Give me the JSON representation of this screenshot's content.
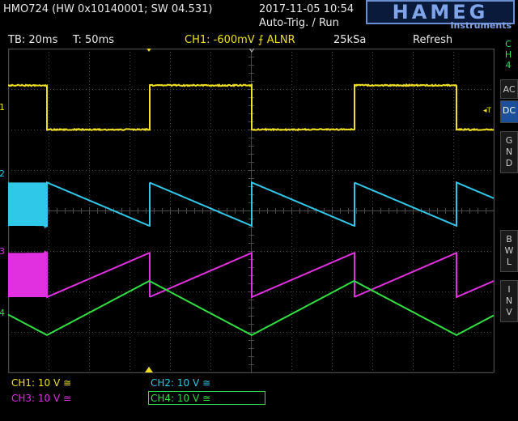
{
  "header": {
    "device_info": "HMO724 (HW 0x10140001; SW 04.531)",
    "datetime": "2017-11-05 10:54",
    "trigger_mode": "Auto-Trig. / Run",
    "logo": "HAMEG",
    "logo_sub": "Instruments"
  },
  "status": {
    "timebase": "TB: 20ms",
    "trigger_time": "T: 50ms",
    "trigger_setting": "CH1: -600mV ⨍ ALNR",
    "sample_rate": "25kSa",
    "acq_mode": "Refresh"
  },
  "sidebar": {
    "channel": [
      "C",
      "H",
      "4"
    ],
    "buttons": [
      {
        "label": "AC",
        "lines": [
          "AC"
        ],
        "active": false
      },
      {
        "label": "DC",
        "lines": [
          "DC"
        ],
        "active": true
      },
      {
        "label": "GND",
        "lines": [
          "G",
          "N",
          "D"
        ],
        "active": false
      },
      {
        "label": "BWL",
        "lines": [
          "B",
          "W",
          "L"
        ],
        "active": false
      },
      {
        "label": "INV",
        "lines": [
          "I",
          "N",
          "V"
        ],
        "active": false
      }
    ]
  },
  "markers": {
    "ch1": "1",
    "ch2": "2",
    "ch3": "3",
    "ch4": "4",
    "trigger_level": "◂T"
  },
  "footer": {
    "ch1": "CH1: 10 V ≅",
    "ch2": "CH2: 10 V ≅",
    "ch3": "CH3: 10 V ≅",
    "ch4": "CH4: 10 V ≅"
  },
  "colors": {
    "ch1": "#f0e020",
    "ch2": "#30c8e8",
    "ch3": "#e030e0",
    "ch4": "#30e040",
    "grid": "#4a4a4a",
    "active_button": "#1c4f9c"
  },
  "waveforms": {
    "period_ms": 100,
    "ch1": {
      "shape": "square",
      "high_v": 5.3,
      "low_v": 0.0,
      "duty": 0.5
    },
    "ch2": {
      "shape": "sawtooth_falling",
      "max_v": 2.1,
      "min_v": -3.1
    },
    "ch3": {
      "shape": "sawtooth_rising",
      "max_v": 2.1,
      "min_v": -3.2
    },
    "ch4": {
      "shape": "triangle",
      "max_v": 3.5,
      "min_v": -3.0
    }
  }
}
